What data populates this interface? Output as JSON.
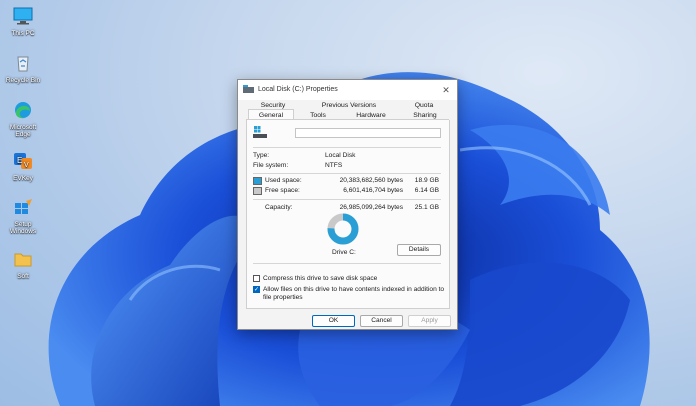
{
  "desktop": {
    "icons": [
      {
        "label": "This PC",
        "icon": "monitor-icon"
      },
      {
        "label": "Recycle Bin",
        "icon": "recycle-bin-icon"
      },
      {
        "label": "Microsoft Edge",
        "icon": "edge-icon"
      },
      {
        "label": "EVKey",
        "icon": "evkey-icon"
      },
      {
        "label": "Setup Windows",
        "icon": "setup-icon"
      },
      {
        "label": "Soft",
        "icon": "folder-icon"
      }
    ]
  },
  "dialog": {
    "title": "Local Disk (C:) Properties",
    "close_glyph": "✕",
    "tabs_row1": [
      "Security",
      "Previous Versions",
      "Quota"
    ],
    "tabs_row2": [
      "General",
      "Tools",
      "Hardware",
      "Sharing"
    ],
    "selected_tab": "General",
    "name_value": "",
    "type_label": "Type:",
    "type_value": "Local Disk",
    "fs_label": "File system:",
    "fs_value": "NTFS",
    "used_label": "Used space:",
    "used_bytes": "20,383,682,560 bytes",
    "used_gb": "18.9 GB",
    "free_label": "Free space:",
    "free_bytes": "6,601,416,704 bytes",
    "free_gb": "6.14 GB",
    "capacity_label": "Capacity:",
    "capacity_bytes": "26,985,099,264 bytes",
    "capacity_gb": "25.1 GB",
    "drive_label": "Drive C:",
    "details_label": "Details",
    "compress_label": "Compress this drive to save disk space",
    "compress_checked": false,
    "index_label_line1": "Allow files on this drive to have contents indexed in addition to",
    "index_label_line2": "file properties",
    "index_checked": true,
    "used_fraction": 0.755,
    "colors": {
      "used": "#2a9fd6",
      "free": "#c9c9c9",
      "accent": "#0067c0"
    },
    "buttons": {
      "ok": "OK",
      "cancel": "Cancel",
      "apply": "Apply"
    }
  }
}
